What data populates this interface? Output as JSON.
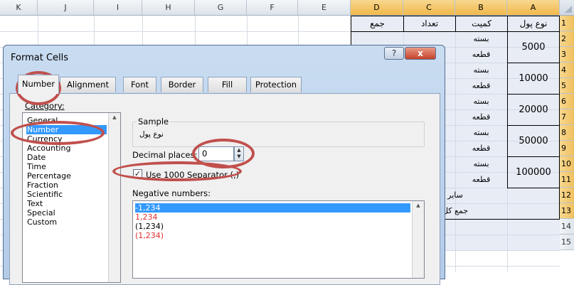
{
  "spreadsheet": {
    "columns": [
      "K",
      "J",
      "I",
      "H",
      "G",
      "F",
      "E",
      "D",
      "C",
      "B",
      "A"
    ],
    "rows": [
      "1",
      "2",
      "3",
      "4",
      "5",
      "6",
      "7",
      "8",
      "9",
      "10",
      "11",
      "12",
      "13",
      "14",
      "15"
    ],
    "headers": {
      "D": "جمع",
      "C": "تعداد",
      "B": "کمیت",
      "A": "نوع پول"
    },
    "cells": {
      "B2": "بسته",
      "B3": "قطعه",
      "B4": "بسته",
      "B5": "قطعه",
      "B6": "بسته",
      "B7": "قطعه",
      "B8": "بسته",
      "B9": "قطعه",
      "B10": "بسته",
      "B11": "قطعه",
      "B12": "سایر",
      "B13": "جمع کل",
      "A2": "5000",
      "A4": "10000",
      "A6": "20000",
      "A8": "50000",
      "A10": "100000"
    }
  },
  "dialog": {
    "title": "Format Cells",
    "help_label": "?",
    "close_label": "x",
    "tabs": [
      "Number",
      "Alignment",
      "Font",
      "Border",
      "Fill",
      "Protection"
    ],
    "category_label": "Category:",
    "categories": [
      "General",
      "Number",
      "Currency",
      "Accounting",
      "Date",
      "Time",
      "Percentage",
      "Fraction",
      "Scientific",
      "Text",
      "Special",
      "Custom"
    ],
    "selected_category": "Number",
    "sample_label": "Sample",
    "sample_value": "نوع پول",
    "decimal_label": "Decimal places:",
    "decimal_value": "0",
    "separator_label": "Use 1000 Separator (,)",
    "separator_checked": true,
    "negative_label": "Negative numbers:",
    "negative_options": [
      "-1,234",
      "1,234",
      "(1,234)",
      "(1,234)"
    ],
    "negative_colors": [
      "#000000",
      "#e03030",
      "#000000",
      "#e03030"
    ],
    "accent": "#3399ff",
    "highlight_ring_color": "#c0504d"
  }
}
